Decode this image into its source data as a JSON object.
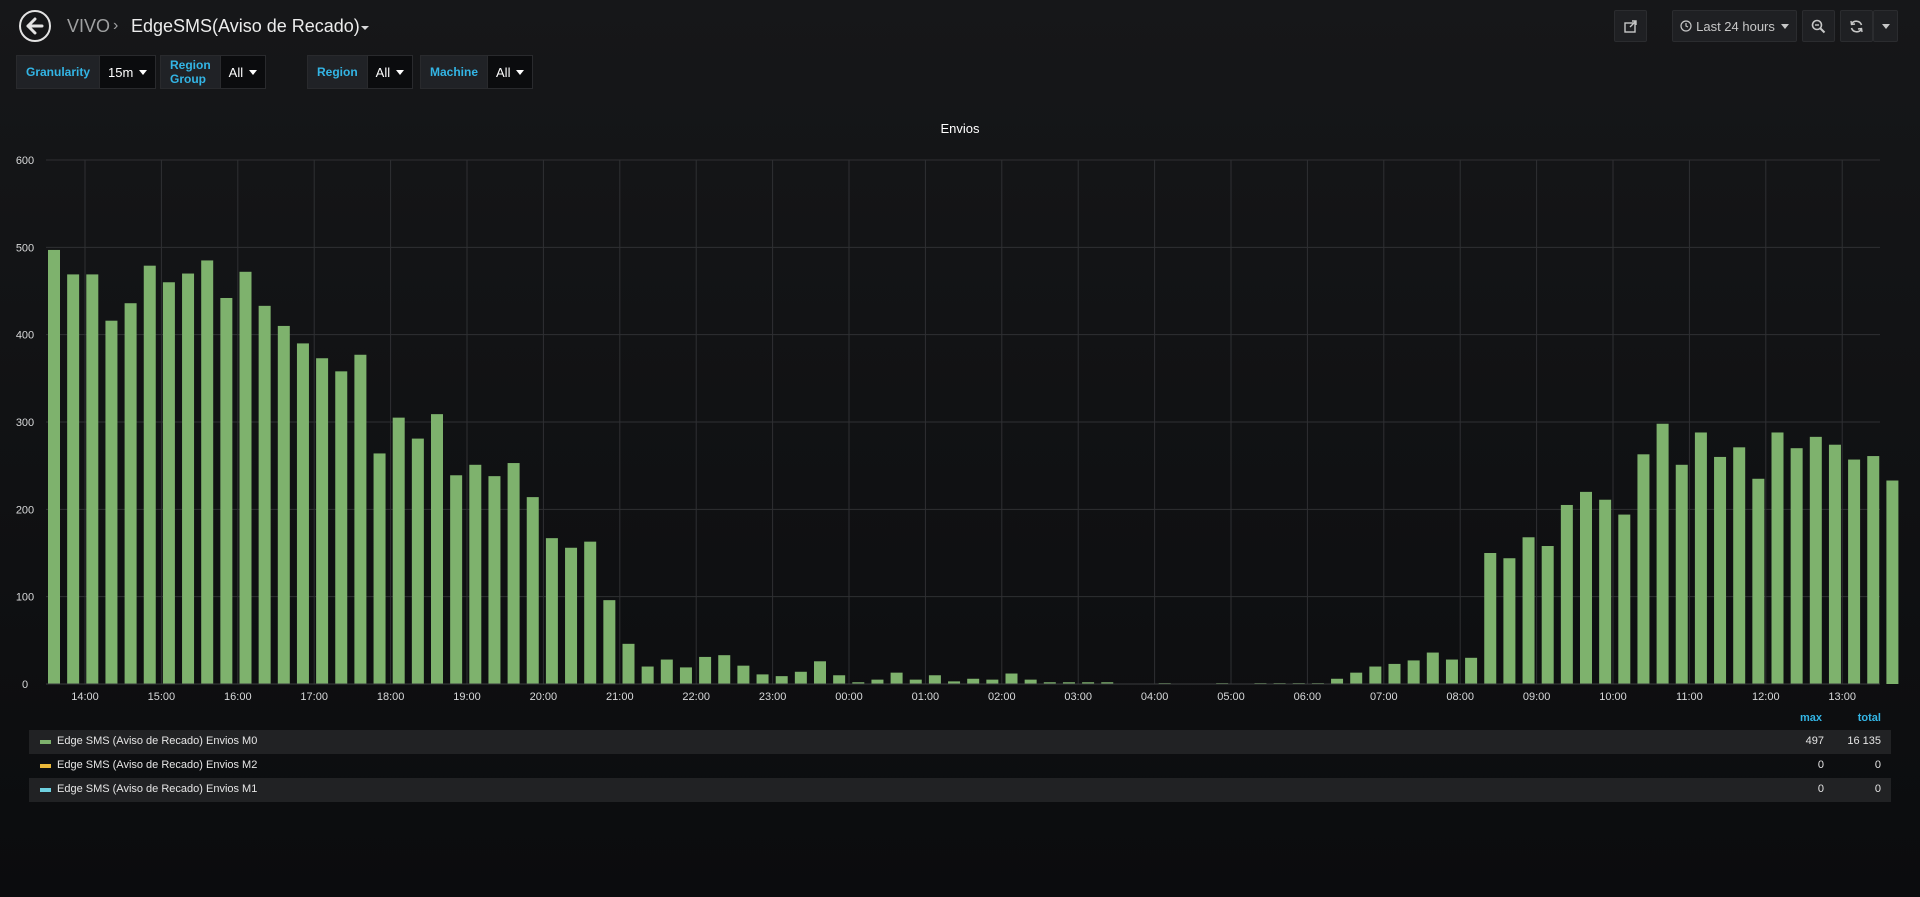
{
  "header": {
    "folder": "VIVO",
    "separator": "›",
    "title": "EdgeSMS(Aviso de Recado)",
    "time_range": "Last 24 hours"
  },
  "variables": [
    {
      "label": "Granularity",
      "value": "15m"
    },
    {
      "label": "Region Group",
      "value": "All"
    },
    {
      "label": "Region",
      "value": "All"
    },
    {
      "label": "Machine",
      "value": "All"
    }
  ],
  "panel": {
    "title": "Envios"
  },
  "colors": {
    "bar": "#7eb26d",
    "accent": "#33b5e5",
    "m2": "#eab839",
    "m1": "#6ed0e0"
  },
  "chart_data": {
    "type": "bar",
    "title": "Envios",
    "ylim": [
      0,
      600
    ],
    "y_ticks": [
      "0",
      "100",
      "200",
      "300",
      "400",
      "500",
      "600"
    ],
    "x_ticks": [
      "14:00",
      "15:00",
      "16:00",
      "17:00",
      "18:00",
      "19:00",
      "20:00",
      "21:00",
      "22:00",
      "23:00",
      "00:00",
      "01:00",
      "02:00",
      "03:00",
      "04:00",
      "05:00",
      "06:00",
      "07:00",
      "08:00",
      "09:00",
      "10:00",
      "11:00",
      "12:00",
      "13:00"
    ],
    "grid": true,
    "series": [
      {
        "name": "Edge SMS (Aviso de Recado) Envios M0",
        "values": [
          497,
          469,
          469,
          416,
          436,
          479,
          460,
          470,
          485,
          442,
          472,
          433,
          410,
          390,
          373,
          358,
          377,
          264,
          305,
          281,
          309,
          239,
          251,
          238,
          253,
          214,
          167,
          156,
          163,
          96,
          46,
          20,
          28,
          19,
          31,
          33,
          21,
          11,
          9,
          14,
          26,
          10,
          2,
          5,
          13,
          5,
          10,
          3,
          6,
          5,
          12,
          5,
          2,
          2,
          2,
          2,
          0,
          0,
          1,
          0,
          0,
          1,
          0,
          1,
          1,
          1,
          1,
          6,
          13,
          20,
          23,
          27,
          36,
          28,
          30,
          150,
          144,
          168,
          158,
          205,
          220,
          211,
          194,
          263,
          298,
          251,
          288,
          260,
          271,
          235,
          288,
          270,
          283,
          274,
          257,
          261,
          233
        ]
      }
    ]
  },
  "legend": {
    "headers": {
      "max": "max",
      "total": "total"
    },
    "rows": [
      {
        "name": "Edge SMS (Aviso de Recado) Envios M0",
        "max": "497",
        "total": "16 135",
        "color": "#7eb26d"
      },
      {
        "name": "Edge SMS (Aviso de Recado) Envios M2",
        "max": "0",
        "total": "0",
        "color": "#eab839"
      },
      {
        "name": "Edge SMS (Aviso de Recado) Envios M1",
        "max": "0",
        "total": "0",
        "color": "#6ed0e0"
      }
    ]
  },
  "icons": {
    "back": "arrow-left-icon",
    "share": "share-icon",
    "clock": "clock-icon",
    "zoom": "zoom-out-icon",
    "refresh": "refresh-icon"
  }
}
